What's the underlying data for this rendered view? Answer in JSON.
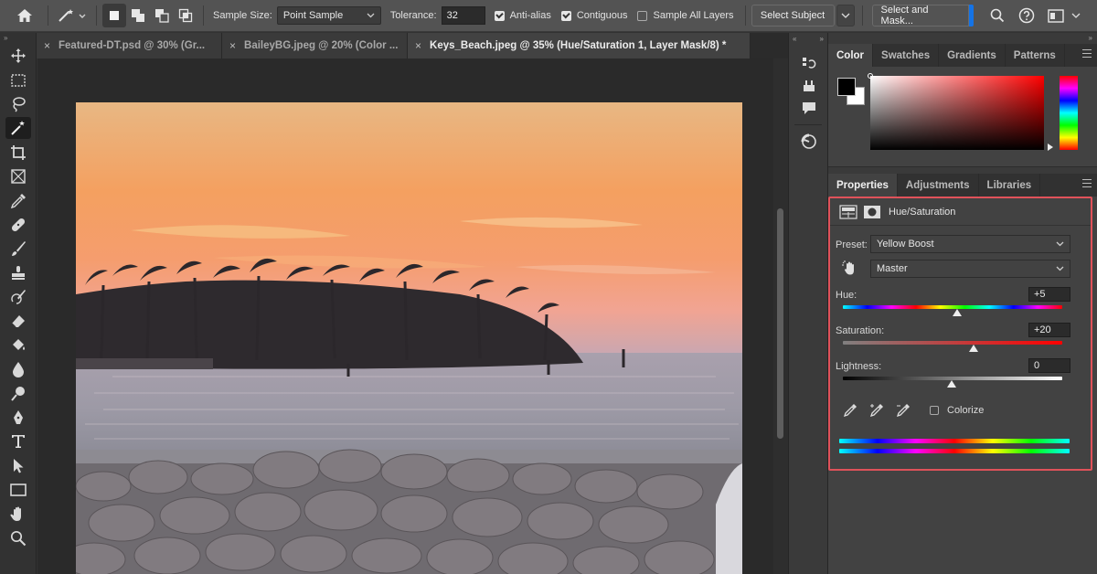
{
  "options_bar": {
    "sample_size_label": "Sample Size:",
    "sample_size_value": "Point Sample",
    "tolerance_label": "Tolerance:",
    "tolerance_value": "32",
    "anti_alias_label": "Anti-alias",
    "anti_alias_checked": true,
    "contiguous_label": "Contiguous",
    "contiguous_checked": true,
    "sample_all_layers_label": "Sample All Layers",
    "sample_all_layers_checked": false,
    "select_subject_label": "Select Subject",
    "select_and_mask_label": "Select and Mask..."
  },
  "document_tabs": [
    {
      "label": "Featured-DT.psd @ 30% (Gr...",
      "active": false
    },
    {
      "label": "BaileyBG.jpeg @ 20% (Color ...",
      "active": false
    },
    {
      "label": "Keys_Beach.jpeg @ 35% (Hue/Saturation 1, Layer Mask/8) *",
      "active": true
    }
  ],
  "color_panel": {
    "tabs": [
      "Color",
      "Swatches",
      "Gradients",
      "Patterns"
    ],
    "active_tab": "Color",
    "foreground": "#000000",
    "background": "#ffffff",
    "hue_color": "#ff0000"
  },
  "properties_panel": {
    "tabs": [
      "Properties",
      "Adjustments",
      "Libraries"
    ],
    "active_tab": "Properties",
    "adjustment_title": "Hue/Saturation",
    "preset_label": "Preset:",
    "preset_value": "Yellow Boost",
    "channel_value": "Master",
    "hue_label": "Hue:",
    "hue_value": "+5",
    "saturation_label": "Saturation:",
    "saturation_value": "+20",
    "lightness_label": "Lightness:",
    "lightness_value": "0",
    "colorize_label": "Colorize",
    "colorize_checked": false,
    "highlight_color": "#e0525a"
  }
}
